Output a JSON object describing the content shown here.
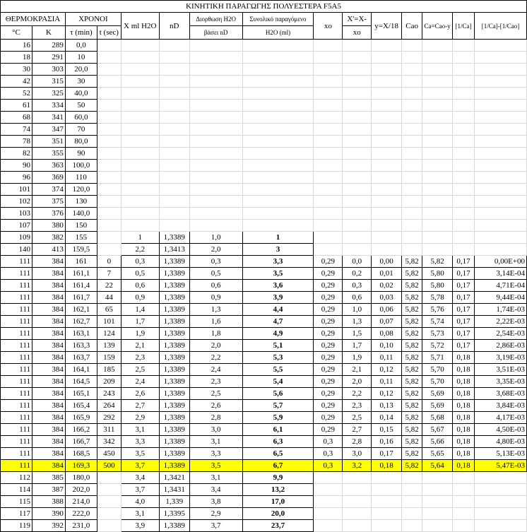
{
  "title": "ΚΙΝΗΤΙΚΗ ΠΑΡΑΓΩΓΗΣ ΠΟΛΥΕΣΤΕΡΑ F5A5",
  "header": {
    "temperature": "ΘΕΡΜΟΚΡΑΣΙΑ",
    "times": "ΧΡΟΝΟΙ",
    "degC": "°C",
    "kelvin": "K",
    "tau": "τ (min)",
    "tsec": "t (sec)",
    "xml": "X ml H2O",
    "nd": "nD",
    "corr_line1": "Διορθωση H2O",
    "corr_line2": "βάσει nD",
    "total_line1": "Συνολικό παραγόμενο",
    "total_line2": "H2O (ml)",
    "xo": "xo",
    "xx_line1": "X'=X-",
    "xx_line2": "xo",
    "y": "y=X/18",
    "cao": "Cao",
    "ca": "Ca=Cao-y",
    "inv_ca": "[1/Ca]",
    "diff": "[1/Ca]-[1/Cao]"
  },
  "rows": [
    [
      "16",
      "289",
      "0,0",
      "",
      "",
      "",
      "",
      "",
      "",
      "",
      "",
      "",
      "",
      "",
      "",
      ""
    ],
    [
      "18",
      "291",
      "10",
      "",
      "",
      "",
      "",
      "",
      "",
      "",
      "",
      "",
      "",
      "",
      "",
      ""
    ],
    [
      "30",
      "303",
      "20,0",
      "",
      "",
      "",
      "",
      "",
      "",
      "",
      "",
      "",
      "",
      "",
      "",
      ""
    ],
    [
      "42",
      "315",
      "30",
      "",
      "",
      "",
      "",
      "",
      "",
      "",
      "",
      "",
      "",
      "",
      "",
      ""
    ],
    [
      "52",
      "325",
      "40,0",
      "",
      "",
      "",
      "",
      "",
      "",
      "",
      "",
      "",
      "",
      "",
      "",
      ""
    ],
    [
      "61",
      "334",
      "50",
      "",
      "",
      "",
      "",
      "",
      "",
      "",
      "",
      "",
      "",
      "",
      "",
      ""
    ],
    [
      "68",
      "341",
      "60,0",
      "",
      "",
      "",
      "",
      "",
      "",
      "",
      "",
      "",
      "",
      "",
      "",
      ""
    ],
    [
      "74",
      "347",
      "70",
      "",
      "",
      "",
      "",
      "",
      "",
      "",
      "",
      "",
      "",
      "",
      "",
      ""
    ],
    [
      "78",
      "351",
      "80,0",
      "",
      "",
      "",
      "",
      "",
      "",
      "",
      "",
      "",
      "",
      "",
      "",
      ""
    ],
    [
      "82",
      "355",
      "90",
      "",
      "",
      "",
      "",
      "",
      "",
      "",
      "",
      "",
      "",
      "",
      "",
      ""
    ],
    [
      "90",
      "363",
      "100,0",
      "",
      "",
      "",
      "",
      "",
      "",
      "",
      "",
      "",
      "",
      "",
      "",
      ""
    ],
    [
      "96",
      "369",
      "110",
      "",
      "",
      "",
      "",
      "",
      "",
      "",
      "",
      "",
      "",
      "",
      "",
      ""
    ],
    [
      "101",
      "374",
      "120,0",
      "",
      "",
      "",
      "",
      "",
      "",
      "",
      "",
      "",
      "",
      "",
      "",
      ""
    ],
    [
      "102",
      "375",
      "130",
      "",
      "",
      "",
      "",
      "",
      "",
      "",
      "",
      "",
      "",
      "",
      "",
      ""
    ],
    [
      "103",
      "376",
      "140,0",
      "",
      "",
      "",
      "",
      "",
      "",
      "",
      "",
      "",
      "",
      "",
      "",
      ""
    ],
    [
      "107",
      "380",
      "150",
      "",
      "",
      "",
      "",
      "",
      "",
      "",
      "",
      "",
      "",
      "",
      "",
      ""
    ],
    [
      "109",
      "382",
      "155",
      "",
      "1",
      "1,3389",
      "1,0",
      "1",
      "",
      "",
      "",
      "",
      "",
      "",
      "",
      ""
    ],
    [
      "140",
      "413",
      "159,5",
      "",
      "2,2",
      "1,3413",
      "2,0",
      "3",
      "",
      "",
      "",
      "",
      "",
      "",
      "",
      ""
    ],
    [
      "111",
      "384",
      "161",
      "0",
      "0,3",
      "1,3389",
      "0,3",
      "3,3",
      "0,29",
      "0,0",
      "0,00",
      "5,82",
      "5,82",
      "0,17",
      "0,00E+00",
      ""
    ],
    [
      "111",
      "384",
      "161,1",
      "7",
      "0,5",
      "1,3389",
      "0,5",
      "3,5",
      "0,29",
      "0,2",
      "0,01",
      "5,82",
      "5,80",
      "0,17",
      "3,14E-04",
      ""
    ],
    [
      "111",
      "384",
      "161,4",
      "22",
      "0,6",
      "1,3389",
      "0,6",
      "3,6",
      "0,29",
      "0,3",
      "0,02",
      "5,82",
      "5,80",
      "0,17",
      "4,71E-04",
      ""
    ],
    [
      "111",
      "384",
      "161,7",
      "44",
      "0,9",
      "1,3389",
      "0,9",
      "3,9",
      "0,29",
      "0,6",
      "0,03",
      "5,82",
      "5,78",
      "0,17",
      "9,44E-04",
      ""
    ],
    [
      "111",
      "384",
      "162,1",
      "65",
      "1,4",
      "1,3389",
      "1,3",
      "4,4",
      "0,29",
      "1,0",
      "0,06",
      "5,82",
      "5,76",
      "0,17",
      "1,74E-03",
      ""
    ],
    [
      "111",
      "384",
      "162,7",
      "101",
      "1,7",
      "1,3389",
      "1,6",
      "4,7",
      "0,29",
      "1,3",
      "0,07",
      "5,82",
      "5,74",
      "0,17",
      "2,22E-03",
      ""
    ],
    [
      "111",
      "384",
      "163,1",
      "124",
      "1,9",
      "1,3389",
      "1,8",
      "4,9",
      "0,29",
      "1,5",
      "0,08",
      "5,82",
      "5,73",
      "0,17",
      "2,54E-03",
      ""
    ],
    [
      "111",
      "384",
      "163,3",
      "139",
      "2,1",
      "1,3389",
      "2,0",
      "5,1",
      "0,29",
      "1,7",
      "0,10",
      "5,82",
      "5,72",
      "0,17",
      "2,86E-03",
      ""
    ],
    [
      "111",
      "384",
      "163,7",
      "159",
      "2,3",
      "1,3389",
      "2,2",
      "5,3",
      "0,29",
      "1,9",
      "0,11",
      "5,82",
      "5,71",
      "0,18",
      "3,19E-03",
      ""
    ],
    [
      "111",
      "384",
      "164,1",
      "185",
      "2,5",
      "1,3389",
      "2,4",
      "5,5",
      "0,29",
      "2,1",
      "0,12",
      "5,82",
      "5,70",
      "0,18",
      "3,51E-03",
      ""
    ],
    [
      "111",
      "384",
      "164,5",
      "209",
      "2,4",
      "1,3389",
      "2,3",
      "5,4",
      "0,29",
      "2,0",
      "0,11",
      "5,82",
      "5,70",
      "0,18",
      "3,35E-03",
      ""
    ],
    [
      "111",
      "384",
      "165,1",
      "243",
      "2,6",
      "1,3389",
      "2,5",
      "5,6",
      "0,29",
      "2,2",
      "0,12",
      "5,82",
      "5,69",
      "0,18",
      "3,68E-03",
      ""
    ],
    [
      "111",
      "384",
      "165,4",
      "264",
      "2,7",
      "1,3389",
      "2,6",
      "5,7",
      "0,29",
      "2,3",
      "0,13",
      "5,82",
      "5,69",
      "0,18",
      "3,84E-03",
      ""
    ],
    [
      "111",
      "384",
      "165,9",
      "292",
      "2,9",
      "1,3389",
      "2,8",
      "5,9",
      "0,29",
      "2,5",
      "0,14",
      "5,82",
      "5,68",
      "0,18",
      "4,17E-03",
      ""
    ],
    [
      "111",
      "384",
      "166,2",
      "311",
      "3,1",
      "1,3389",
      "3,0",
      "6,1",
      "0,29",
      "2,7",
      "0,15",
      "5,82",
      "5,67",
      "0,18",
      "4,50E-03",
      ""
    ],
    [
      "111",
      "384",
      "166,7",
      "342",
      "3,3",
      "1,3389",
      "3,1",
      "6,3",
      "0,3",
      "2,8",
      "0,16",
      "5,82",
      "5,66",
      "0,18",
      "4,80E-03",
      ""
    ],
    [
      "111",
      "384",
      "168,5",
      "450",
      "3,5",
      "1,3389",
      "3,3",
      "6,5",
      "0,3",
      "3,0",
      "0,17",
      "5,82",
      "5,65",
      "0,18",
      "5,13E-03",
      ""
    ],
    [
      "111",
      "384",
      "169,3",
      "500",
      "3,7",
      "1,3389",
      "3,5",
      "6,7",
      "0,3",
      "3,2",
      "0,18",
      "5,82",
      "5,64",
      "0,18",
      "5,47E-03",
      ""
    ],
    [
      "112",
      "385",
      "180,0",
      "",
      "3,4",
      "1,3421",
      "3,1",
      "9,9",
      "",
      "",
      "",
      "",
      "",
      "",
      "",
      ""
    ],
    [
      "114",
      "387",
      "202,0",
      "",
      "3,7",
      "1,3431",
      "3,4",
      "13,2",
      "",
      "",
      "",
      "",
      "",
      "",
      "",
      ""
    ],
    [
      "115",
      "388",
      "214,0",
      "",
      "4,0",
      "1,339",
      "3,8",
      "17,0",
      "",
      "",
      "",
      "",
      "",
      "",
      "",
      ""
    ],
    [
      "117",
      "390",
      "222,0",
      "",
      "3,1",
      "1,3395",
      "2,9",
      "20,0",
      "",
      "",
      "",
      "",
      "",
      "",
      "",
      ""
    ],
    [
      "119",
      "392",
      "231,0",
      "",
      "3,9",
      "1,3389",
      "3,7",
      "23,7",
      "",
      "",
      "",
      "",
      "",
      "",
      "",
      ""
    ]
  ],
  "highlight_color": "#ffff00",
  "highlight_row": 35
}
